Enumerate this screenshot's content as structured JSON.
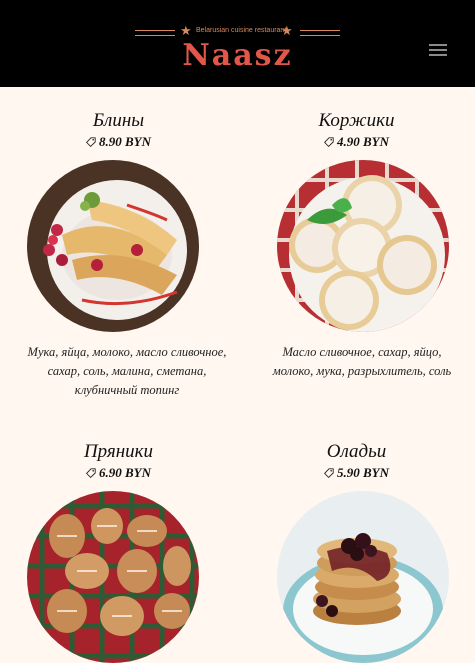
{
  "header": {
    "tagline": "Belarusian cuisine restaurant",
    "brand": "Naasz"
  },
  "menu": [
    {
      "name": "Блины",
      "price": "8.90 BYN",
      "description": "Мука, яйца, молоко, масло сливочное, сахар, соль, малина, сметана, клубничный топинг",
      "image": "blini-photo"
    },
    {
      "name": "Коржики",
      "price": "4.90 BYN",
      "description": "Масло сливочное, сахар, яйцо, молоко, мука, разрыхлитель, соль",
      "image": "korzhiki-photo"
    },
    {
      "name": "Пряники",
      "price": "6.90 BYN",
      "image": "pryaniki-photo"
    },
    {
      "name": "Оладьи",
      "price": "5.90 BYN",
      "image": "oladyi-photo"
    }
  ],
  "icons": {
    "menu": "hamburger-icon",
    "price": "price-tag-icon",
    "ornament": "star-icon"
  },
  "colors": {
    "header_bg": "#000000",
    "brand": "#e3574b",
    "ornament": "#d8895a",
    "page_bg": "#fff7f0"
  }
}
